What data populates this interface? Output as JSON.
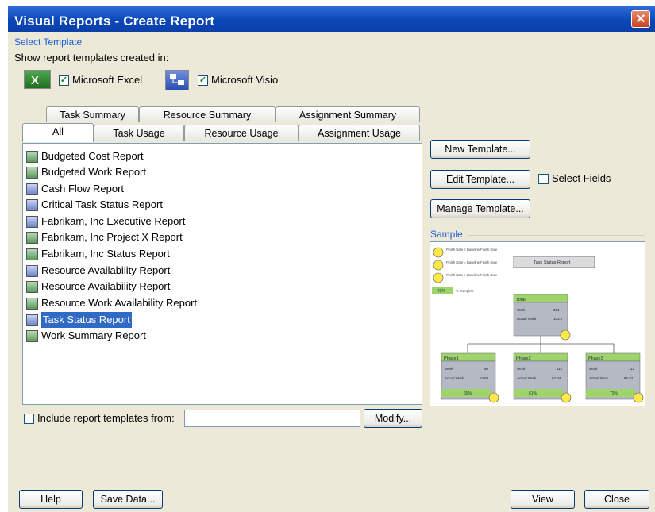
{
  "window": {
    "title": "Visual Reports - Create Report",
    "close_glyph": "✕"
  },
  "select_template": {
    "label": "Select Template",
    "show_label": "Show report templates created in:",
    "excel_checkbox": {
      "label": "Microsoft Excel",
      "checked": true,
      "glyph": "✓"
    },
    "visio_checkbox": {
      "label": "Microsoft Visio",
      "checked": true,
      "glyph": "✓"
    }
  },
  "tabs_row1": [
    "Task Summary",
    "Resource Summary",
    "Assignment Summary"
  ],
  "tabs_row2": [
    "All",
    "Task Usage",
    "Resource Usage",
    "Assignment Usage"
  ],
  "active_tab": "All",
  "reports": [
    {
      "label": "Budgeted Cost Report",
      "icon": "excel-icon"
    },
    {
      "label": "Budgeted Work Report",
      "icon": "excel-icon"
    },
    {
      "label": "Cash Flow Report",
      "icon": "visio-icon"
    },
    {
      "label": "Critical Task Status Report",
      "icon": "visio-icon"
    },
    {
      "label": "Fabrikam, Inc Executive Report",
      "icon": "visio-icon"
    },
    {
      "label": "Fabrikam, Inc Project X Report",
      "icon": "excel-icon"
    },
    {
      "label": "Fabrikam, Inc Status Report",
      "icon": "excel-icon"
    },
    {
      "label": "Resource Availability Report",
      "icon": "visio-icon"
    },
    {
      "label": "Resource Availability Report",
      "icon": "excel-icon"
    },
    {
      "label": "Resource Work Availability Report",
      "icon": "excel-icon"
    },
    {
      "label": "Task Status Report",
      "icon": "visio-icon",
      "selected": true
    },
    {
      "label": "Work Summary Report",
      "icon": "excel-icon"
    }
  ],
  "buttons": {
    "new_template": "New Template...",
    "edit_template": "Edit Template...",
    "manage_template": "Manage Template...",
    "modify": "Modify...",
    "help": "Help",
    "save_data": "Save Data...",
    "view": "View",
    "close": "Close"
  },
  "select_fields": {
    "label": "Select Fields",
    "checked": false
  },
  "sample": {
    "label": "Sample",
    "legend": [
      "Finish Date < Baseline Finish Date",
      "Finish Date = Baseline Finish Date",
      "Finish Date > Baseline Finish Date"
    ],
    "percent_label": "% Complete",
    "legend_value": "43%",
    "title_box": "Task Status Report",
    "total": {
      "name": "Total",
      "work_label": "Work",
      "work": "304",
      "actual_label": "Actual Work",
      "actual": "103.2"
    },
    "phases": [
      {
        "name": "Phase1",
        "work_label": "Work",
        "work": "80",
        "actual_label": "Actual Work",
        "actual": "53.89",
        "pct": "65%"
      },
      {
        "name": "Phase2",
        "work_label": "Work",
        "work": "112",
        "actual_label": "Actual Work",
        "actual": "67.84",
        "pct": "61%"
      },
      {
        "name": "Phase3",
        "work_label": "Work",
        "work": "112",
        "actual_label": "Actual Work",
        "actual": "85.52",
        "pct": "73%"
      }
    ]
  },
  "include_templates": {
    "label": "Include report templates from:",
    "checked": false,
    "value": ""
  },
  "colors": {
    "title_bar": "#0a47b8",
    "selection": "#316ac5",
    "dialog_bg": "#ece9d8",
    "sample_node": "#9fd46b"
  }
}
